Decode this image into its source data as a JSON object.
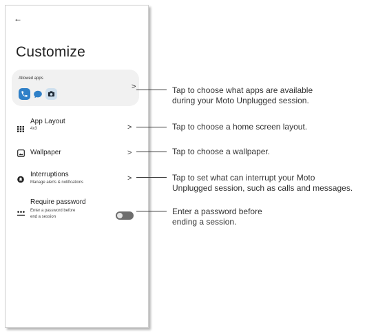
{
  "screen": {
    "back_icon": "arrow-left-icon",
    "title": "Customize",
    "allowed_apps": {
      "label": "Allowed apps",
      "apps": [
        "phone-app-icon",
        "messages-app-icon",
        "camera-app-icon"
      ]
    },
    "rows": [
      {
        "title": "App Layout",
        "subtitle": "4x3",
        "icon": "grid-icon"
      },
      {
        "title": "Wallpaper",
        "subtitle": "",
        "icon": "wallpaper-icon"
      },
      {
        "title": "Interruptions",
        "subtitle": "Manage alerts & notifications",
        "icon": "do-not-disturb-icon"
      },
      {
        "title": "Require password",
        "subtitle_line1": "Enter a password before",
        "subtitle_line2": "end a session",
        "icon": "password-icon",
        "toggle_on": false
      }
    ]
  },
  "callouts": {
    "allowed_apps_line1": "Tap to choose what apps are available",
    "allowed_apps_line2": "during your Moto Unplugged session.",
    "app_layout": "Tap to choose a home screen layout.",
    "wallpaper": "Tap to choose a wallpaper.",
    "interruptions_line1": "Tap to set what can interrupt your Moto",
    "interruptions_line2": "Unplugged session, such as calls and messages.",
    "password_line1": "Enter a password before",
    "password_line2": "ending a session."
  },
  "colors": {
    "accent_blue": "#2f80c8",
    "card_bg": "#f1f1f1",
    "toggle_off": "#6d6d6d"
  }
}
